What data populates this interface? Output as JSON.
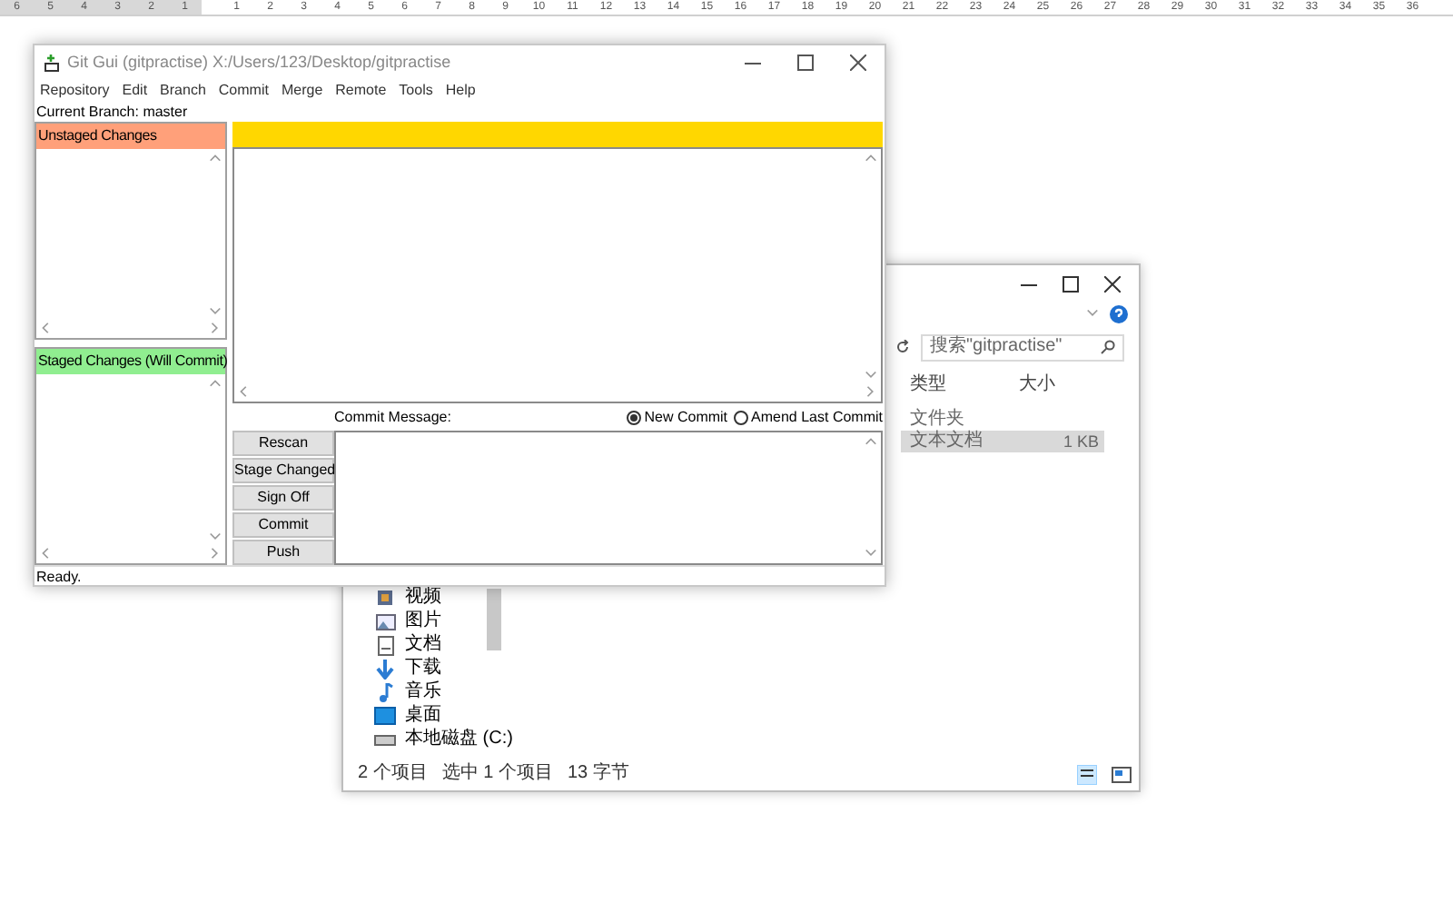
{
  "ruler": {
    "left_numbers": [
      "6",
      "5",
      "4",
      "3",
      "2",
      "1"
    ],
    "numbers": [
      "1",
      "2",
      "3",
      "4",
      "5",
      "6",
      "7",
      "8",
      "9",
      "10",
      "11",
      "12",
      "13",
      "14",
      "15",
      "16",
      "17",
      "18",
      "19",
      "20",
      "21",
      "22",
      "23",
      "24",
      "25",
      "26",
      "27",
      "28",
      "29",
      "30",
      "31",
      "32",
      "33",
      "34",
      "35",
      "36"
    ]
  },
  "explorer": {
    "search": {
      "placeholder": "搜索\"gitpractise\""
    },
    "columns": [
      "类型",
      "大小"
    ],
    "rows": [
      {
        "type": "文件夹",
        "selected": false
      },
      {
        "type": "文本文档",
        "size": "1 KB",
        "selected": true
      }
    ],
    "nav_items": [
      {
        "label": "视频",
        "kind": "video"
      },
      {
        "label": "图片",
        "kind": "image"
      },
      {
        "label": "文档",
        "kind": "document"
      },
      {
        "label": "下载",
        "kind": "download"
      },
      {
        "label": "音乐",
        "kind": "music"
      },
      {
        "label": "桌面",
        "kind": "desktop"
      },
      {
        "label": "本地磁盘 (C:)",
        "kind": "drive"
      }
    ],
    "status": [
      "2 个项目",
      "选中 1 个项目",
      "13 字节"
    ]
  },
  "git_gui": {
    "title": "Git Gui (gitpractise) X:/Users/123/Desktop/gitpractise",
    "menu": [
      "Repository",
      "Edit",
      "Branch",
      "Commit",
      "Merge",
      "Remote",
      "Tools",
      "Help"
    ],
    "current_branch": "Current Branch: master",
    "unstaged_header": "Unstaged Changes",
    "staged_header": "Staged Changes (Will Commit)",
    "commit_label": "Commit Message:",
    "commit_modes": [
      {
        "label": "New Commit",
        "selected": true
      },
      {
        "label": "Amend Last Commit",
        "selected": false
      }
    ],
    "buttons": [
      "Rescan",
      "Stage Changed",
      "Sign Off",
      "Commit",
      "Push"
    ],
    "status": "Ready."
  }
}
